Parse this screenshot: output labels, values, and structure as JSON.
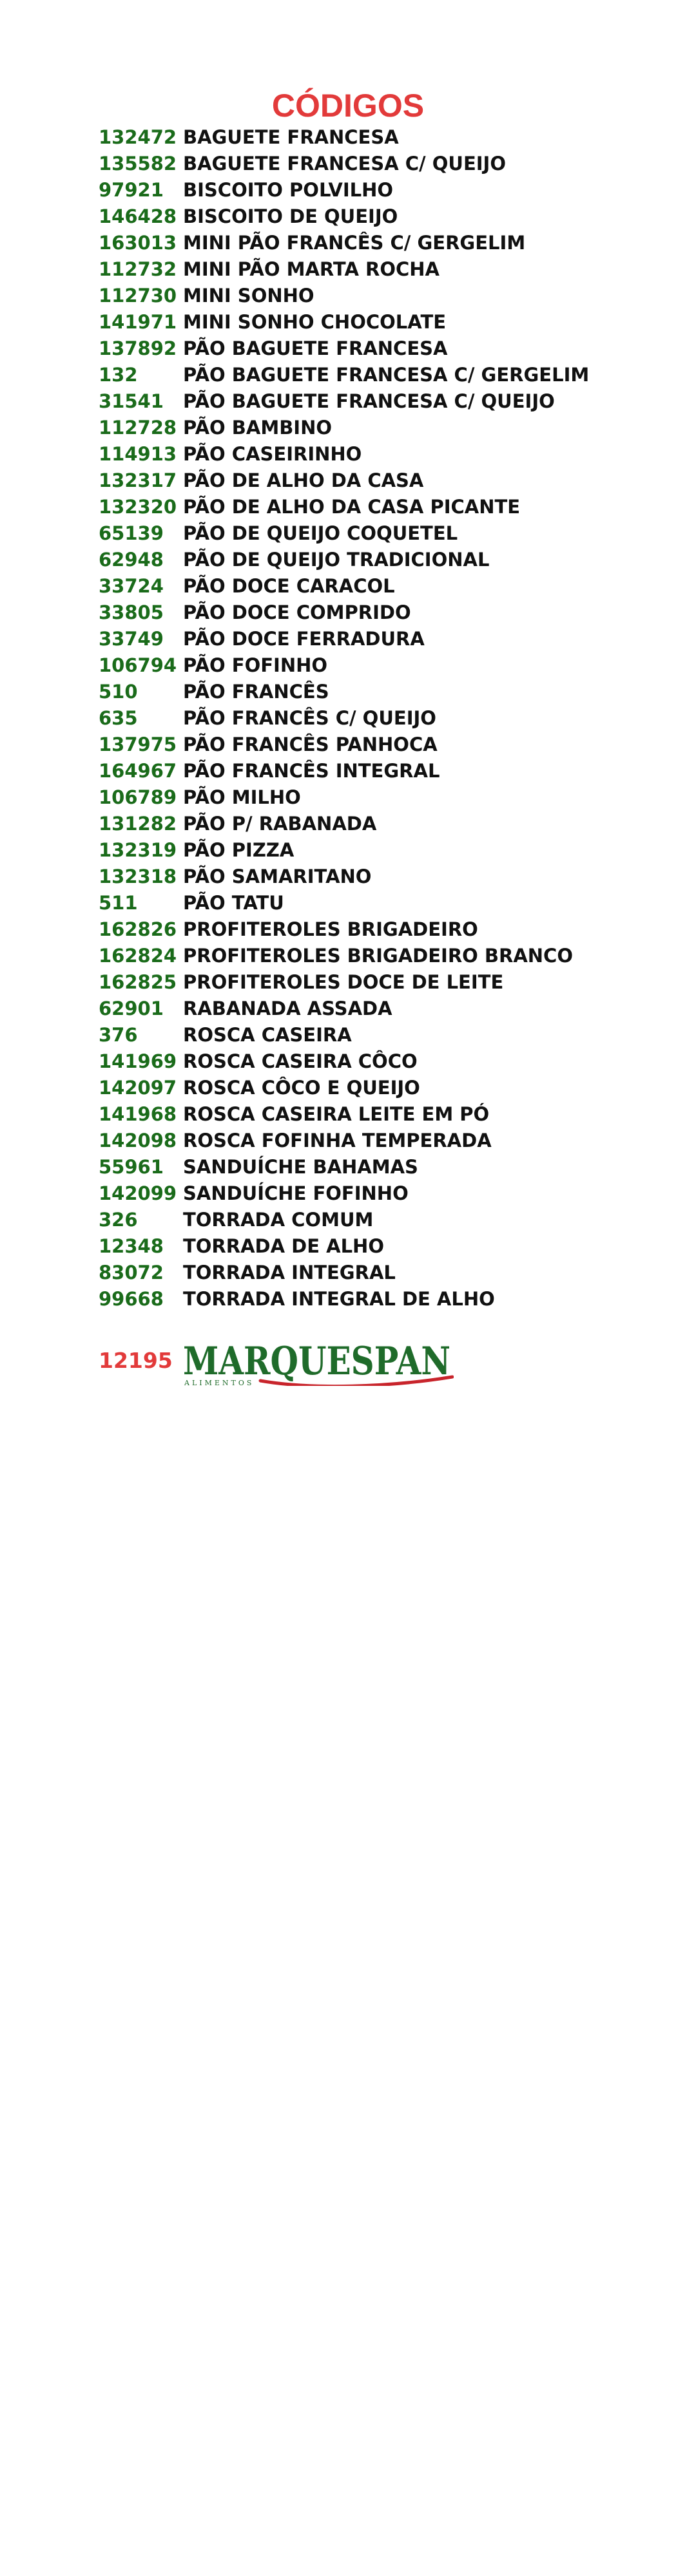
{
  "title": "CÓDIGOS",
  "items": [
    {
      "code": "132472",
      "name": "BAGUETE FRANCESA"
    },
    {
      "code": "135582",
      "name": "BAGUETE FRANCESA C/ QUEIJO"
    },
    {
      "code": "97921",
      "name": "BISCOITO POLVILHO"
    },
    {
      "code": "146428",
      "name": "BISCOITO DE QUEIJO"
    },
    {
      "code": "163013",
      "name": "MINI PÃO FRANCÊS C/ GERGELIM"
    },
    {
      "code": "112732",
      "name": "MINI PÃO MARTA ROCHA"
    },
    {
      "code": "112730",
      "name": "MINI SONHO"
    },
    {
      "code": "141971",
      "name": "MINI SONHO CHOCOLATE"
    },
    {
      "code": "137892",
      "name": "PÃO BAGUETE FRANCESA"
    },
    {
      "code": "132",
      "name": "PÃO BAGUETE FRANCESA C/ GERGELIM"
    },
    {
      "code": "31541",
      "name": "PÃO BAGUETE FRANCESA C/ QUEIJO"
    },
    {
      "code": "112728",
      "name": "PÃO BAMBINO"
    },
    {
      "code": "114913",
      "name": "PÃO CASEIRINHO"
    },
    {
      "code": "132317",
      "name": "PÃO DE ALHO DA CASA"
    },
    {
      "code": "132320",
      "name": "PÃO DE ALHO DA CASA PICANTE"
    },
    {
      "code": "65139",
      "name": "PÃO DE QUEIJO COQUETEL"
    },
    {
      "code": "62948",
      "name": "PÃO DE QUEIJO TRADICIONAL"
    },
    {
      "code": "33724",
      "name": "PÃO DOCE CARACOL"
    },
    {
      "code": "33805",
      "name": "PÃO DOCE COMPRIDO"
    },
    {
      "code": "33749",
      "name": "PÃO DOCE FERRADURA"
    },
    {
      "code": "106794",
      "name": "PÃO FOFINHO"
    },
    {
      "code": "510",
      "name": "PÃO FRANCÊS"
    },
    {
      "code": "635",
      "name": "PÃO FRANCÊS C/ QUEIJO"
    },
    {
      "code": "137975",
      "name": "PÃO FRANCÊS PANHOCA"
    },
    {
      "code": "164967",
      "name": "PÃO FRANCÊS INTEGRAL"
    },
    {
      "code": "106789",
      "name": "PÃO MILHO"
    },
    {
      "code": "131282",
      "name": "PÃO P/ RABANADA"
    },
    {
      "code": "132319",
      "name": "PÃO PIZZA"
    },
    {
      "code": "132318",
      "name": "PÃO SAMARITANO"
    },
    {
      "code": "511",
      "name": "PÃO TATU"
    },
    {
      "code": "162826",
      "name": "PROFITEROLES BRIGADEIRO"
    },
    {
      "code": "162824",
      "name": "PROFITEROLES BRIGADEIRO BRANCO"
    },
    {
      "code": "162825",
      "name": "PROFITEROLES DOCE DE LEITE"
    },
    {
      "code": "62901",
      "name": "RABANADA ASSADA"
    },
    {
      "code": "376",
      "name": "ROSCA CASEIRA"
    },
    {
      "code": "141969",
      "name": "ROSCA CASEIRA CÔCO"
    },
    {
      "code": "142097",
      "name": "ROSCA CÔCO E QUEIJO"
    },
    {
      "code": "141968",
      "name": "ROSCA CASEIRA LEITE EM PÓ"
    },
    {
      "code": "142098",
      "name": "ROSCA FOFINHA TEMPERADA"
    },
    {
      "code": "55961",
      "name": "SANDUÍCHE BAHAMAS"
    },
    {
      "code": "142099",
      "name": "SANDUÍCHE FOFINHO"
    },
    {
      "code": "326",
      "name": "TORRADA COMUM"
    },
    {
      "code": "12348",
      "name": "TORRADA DE ALHO"
    },
    {
      "code": "83072",
      "name": "TORRADA INTEGRAL"
    },
    {
      "code": "99668",
      "name": "TORRADA INTEGRAL DE ALHO"
    }
  ],
  "brand": {
    "code": "12195",
    "logo_main": "MARQUESPAN",
    "logo_sub": "ALIMENTOS"
  },
  "colors": {
    "title": "#e23a3a",
    "code": "#1a6b1a",
    "name": "#111111",
    "brand_code": "#e23a3a",
    "logo_green": "#1f6b2a",
    "logo_red": "#c8242b"
  }
}
